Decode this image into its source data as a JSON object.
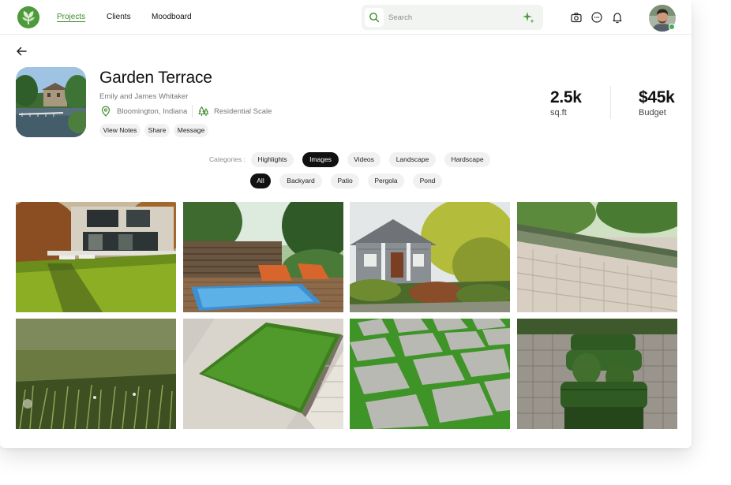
{
  "nav": {
    "items": [
      {
        "label": "Projects",
        "active": true
      },
      {
        "label": "Clients",
        "active": false
      },
      {
        "label": "Moodboard",
        "active": false
      }
    ]
  },
  "search": {
    "placeholder": "Search"
  },
  "project": {
    "title": "Garden Terrace",
    "client": "Emily and James Whitaker",
    "location": "Bloomington, Indiana",
    "scale": "Residential Scale",
    "actions": [
      "View Notes",
      "Share",
      "Message"
    ]
  },
  "stats": [
    {
      "value": "2.5k",
      "label": "sq.ft"
    },
    {
      "value": "$45k",
      "label": "Budget"
    }
  ],
  "filters": {
    "categories_label": "Categories :",
    "categories": [
      {
        "label": "Highlights",
        "active": false
      },
      {
        "label": "Images",
        "active": true
      },
      {
        "label": "Videos",
        "active": false
      },
      {
        "label": "Landscape",
        "active": false
      },
      {
        "label": "Hardscape",
        "active": false
      }
    ],
    "tags": [
      {
        "label": "All",
        "active": true
      },
      {
        "label": "Backyard",
        "active": false
      },
      {
        "label": "Patio",
        "active": false
      },
      {
        "label": "Pergola",
        "active": false
      },
      {
        "label": "Pond",
        "active": false
      }
    ]
  },
  "colors": {
    "brand": "#4f9a3c",
    "active_nav": "#3d8b2d",
    "active_chip": "#111111",
    "online": "#3db04a"
  },
  "gallery_icons": [
    "modern-house-lawn-photo",
    "pool-deck-photo",
    "craftsman-house-photo",
    "stone-wall-photo",
    "grass-closeup-photo",
    "turf-pavers-photo",
    "grid-pavers-photo",
    "hedge-garden-photo"
  ]
}
